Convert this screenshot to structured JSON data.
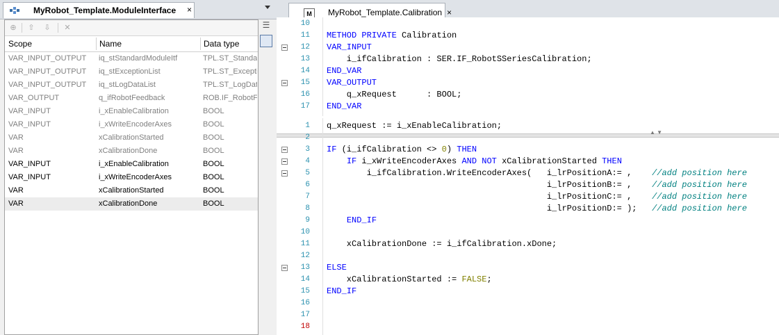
{
  "left_tab": {
    "title": "MyRobot_Template.ModuleInterface",
    "close": "×"
  },
  "right_tab": {
    "title": "MyRobot_Template.Calibration",
    "close": "×",
    "icon_text": "M"
  },
  "toolbar": {
    "buttons": [
      "insert-icon",
      "move-up-icon",
      "move-down-icon",
      "delete-icon"
    ],
    "glyphs": [
      "⊕",
      "⇧",
      "⇩",
      "✕"
    ]
  },
  "var_table": {
    "headers": [
      "Scope",
      "Name",
      "Data type"
    ],
    "rows": [
      {
        "scope": "VAR_INPUT_OUTPUT",
        "name": "iq_stStandardModuleItf",
        "type": "TPL.ST_Standar",
        "inherited": true
      },
      {
        "scope": "VAR_INPUT_OUTPUT",
        "name": "iq_stExceptionList",
        "type": "TPL.ST_Exceptio",
        "inherited": true
      },
      {
        "scope": "VAR_INPUT_OUTPUT",
        "name": "iq_stLogDataList",
        "type": "TPL.ST_LogData",
        "inherited": true
      },
      {
        "scope": "VAR_OUTPUT",
        "name": "q_ifRobotFeedback",
        "type": "ROB.IF_RobotF",
        "inherited": true
      },
      {
        "scope": "VAR_INPUT",
        "name": "i_xEnableCalibration",
        "type": "BOOL",
        "inherited": true
      },
      {
        "scope": "VAR_INPUT",
        "name": "i_xWriteEncoderAxes",
        "type": "BOOL",
        "inherited": true
      },
      {
        "scope": "VAR",
        "name": "xCalibrationStarted",
        "type": "BOOL",
        "inherited": true
      },
      {
        "scope": "VAR",
        "name": "xCalibrationDone",
        "type": "BOOL",
        "inherited": true
      },
      {
        "scope": "VAR_INPUT",
        "name": "i_xEnableCalibration",
        "type": "BOOL",
        "inherited": false
      },
      {
        "scope": "VAR_INPUT",
        "name": "i_xWriteEncoderAxes",
        "type": "BOOL",
        "inherited": false
      },
      {
        "scope": "VAR",
        "name": "xCalibrationStarted",
        "type": "BOOL",
        "inherited": false
      },
      {
        "scope": "VAR",
        "name": "xCalibrationDone",
        "type": "BOOL",
        "inherited": false,
        "selected": true
      }
    ]
  },
  "declaration": {
    "lines": [
      {
        "n": "10",
        "fold": false,
        "t": ""
      },
      {
        "n": "11",
        "fold": false,
        "t": "METHOD PRIVATE Calibration"
      },
      {
        "n": "12",
        "fold": true,
        "t": "VAR_INPUT"
      },
      {
        "n": "13",
        "fold": false,
        "t": "    i_ifCalibration : SER.IF_RobotSSeriesCalibration;"
      },
      {
        "n": "14",
        "fold": false,
        "t": "END_VAR"
      },
      {
        "n": "15",
        "fold": true,
        "t": "VAR_OUTPUT"
      },
      {
        "n": "16",
        "fold": false,
        "t": "    q_xRequest      : BOOL;"
      },
      {
        "n": "17",
        "fold": false,
        "t": "END_VAR"
      }
    ]
  },
  "implementation": {
    "lines": [
      {
        "n": "1",
        "fold": false,
        "t": "q_xRequest := i_xEnableCalibration;"
      },
      {
        "n": "2",
        "fold": false,
        "t": ""
      },
      {
        "n": "3",
        "fold": true,
        "t": "IF (i_ifCalibration <> 0) THEN"
      },
      {
        "n": "4",
        "fold": true,
        "t": "    IF i_xWriteEncoderAxes AND NOT xCalibrationStarted THEN"
      },
      {
        "n": "5",
        "fold": true,
        "t": "        i_ifCalibration.WriteEncoderAxes(   i_lrPositionA:= ,    //add position here"
      },
      {
        "n": "6",
        "fold": false,
        "t": "                                            i_lrPositionB:= ,    //add position here"
      },
      {
        "n": "7",
        "fold": false,
        "t": "                                            i_lrPositionC:= ,    //add position here"
      },
      {
        "n": "8",
        "fold": false,
        "t": "                                            i_lrPositionD:= );   //add position here"
      },
      {
        "n": "9",
        "fold": false,
        "t": "    END_IF"
      },
      {
        "n": "10",
        "fold": false,
        "t": ""
      },
      {
        "n": "11",
        "fold": false,
        "t": "    xCalibrationDone := i_ifCalibration.xDone;"
      },
      {
        "n": "12",
        "fold": false,
        "t": ""
      },
      {
        "n": "13",
        "fold": true,
        "t": "ELSE"
      },
      {
        "n": "14",
        "fold": false,
        "t": "    xCalibrationStarted := FALSE;"
      },
      {
        "n": "15",
        "fold": false,
        "t": "END_IF"
      },
      {
        "n": "16",
        "fold": false,
        "t": ""
      },
      {
        "n": "17",
        "fold": false,
        "t": ""
      },
      {
        "n": "18",
        "fold": false,
        "t": "",
        "current": true
      }
    ]
  },
  "colors": {
    "keyword": "#0000ff",
    "comment": "#008080",
    "number": "#808000",
    "line_number": "#2b91af",
    "current_line_number": "#c00000"
  }
}
